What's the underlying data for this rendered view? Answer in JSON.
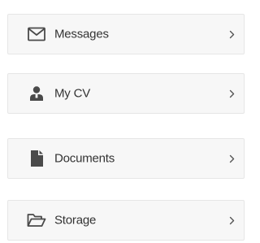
{
  "menu": {
    "items": [
      {
        "label": "Messages",
        "icon": "envelope-icon"
      },
      {
        "label": "My CV",
        "icon": "user-icon"
      },
      {
        "label": "Documents",
        "icon": "document-icon"
      },
      {
        "label": "Storage",
        "icon": "folder-open-icon"
      }
    ],
    "chevron_icon": "chevron-right-icon",
    "colors": {
      "background": "#f7f7f7",
      "border": "#e6e6e6",
      "text": "#333333",
      "icon": "#4a4a4a"
    }
  }
}
